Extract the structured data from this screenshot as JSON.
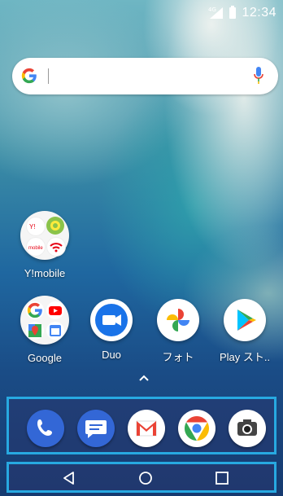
{
  "status_bar": {
    "network": "4G",
    "time": "12:34"
  },
  "search_bar": {
    "logo_icon": "google-g-icon",
    "mic_icon": "microphone-icon"
  },
  "home_apps": [
    {
      "label": "Y!mobile",
      "icon": "ymobile-folder-icon"
    },
    {
      "label": "Google",
      "icon": "google-folder-icon"
    },
    {
      "label": "Duo",
      "icon": "duo-icon"
    },
    {
      "label": "フォト",
      "icon": "photos-icon"
    },
    {
      "label": "Play スト..",
      "icon": "play-store-icon"
    }
  ],
  "dock": [
    {
      "icon": "phone-icon"
    },
    {
      "icon": "messages-icon"
    },
    {
      "icon": "gmail-icon"
    },
    {
      "icon": "chrome-icon"
    },
    {
      "icon": "camera-icon"
    }
  ],
  "nav": [
    "back-icon",
    "home-icon",
    "recents-icon"
  ],
  "colors": {
    "highlight_border": "#27a9e1",
    "dock_background": "#28376e"
  }
}
